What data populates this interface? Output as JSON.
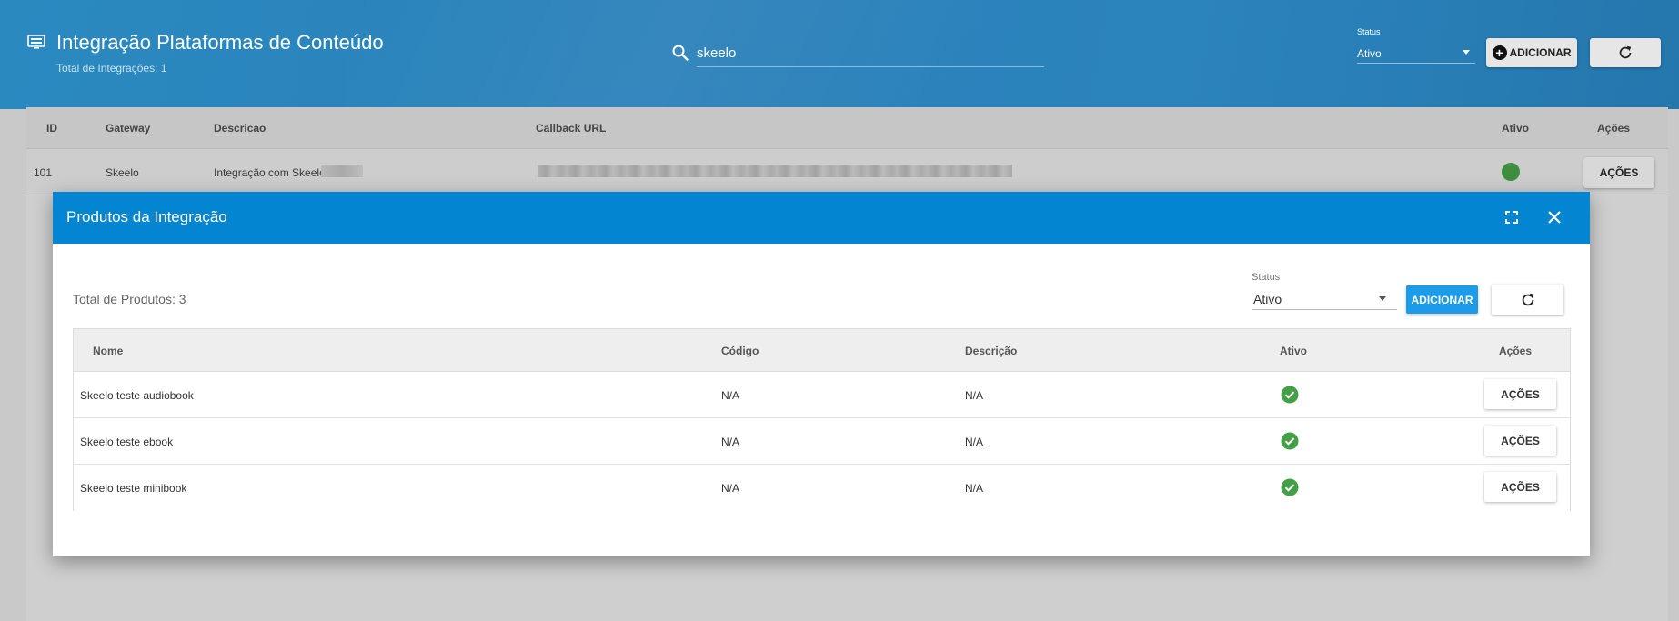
{
  "header": {
    "title": "Integração Plataformas de Conteúdo",
    "subtitle": "Total de Integrações: 1",
    "search_value": "skeelo",
    "status_label": "Status",
    "status_value": "Ativo",
    "add_label": "ADICIONAR",
    "icons": {
      "title": "monitor-list-icon",
      "search": "search-icon",
      "add": "plus-circle-icon",
      "refresh": "refresh-icon"
    }
  },
  "integrations": {
    "columns": [
      "ID",
      "Gateway",
      "Descricao",
      "Callback URL",
      "Ativo",
      "Ações"
    ],
    "rows": [
      {
        "id": "101",
        "gateway": "Skeelo",
        "descricao": "Integração com Skeelo",
        "action_label": "AÇÕES"
      }
    ]
  },
  "dialog": {
    "title": "Produtos da Integração",
    "total": "Total de Produtos: 3",
    "status_label": "Status",
    "status_value": "Ativo",
    "add_label": "ADICIONAR",
    "columns": [
      "Nome",
      "Código",
      "Descrição",
      "Ativo",
      "Ações"
    ],
    "rows": [
      {
        "nome": "Skeelo teste audiobook",
        "codigo": "N/A",
        "descricao": "N/A",
        "action_label": "AÇÕES"
      },
      {
        "nome": "Skeelo teste ebook",
        "codigo": "N/A",
        "descricao": "N/A",
        "action_label": "AÇÕES"
      },
      {
        "nome": "Skeelo teste minibook",
        "codigo": "N/A",
        "descricao": "N/A",
        "action_label": "AÇÕES"
      }
    ],
    "icons": {
      "expand": "fullscreen-icon",
      "close": "close-icon",
      "active": "check-circle-icon"
    }
  },
  "colors": {
    "header": "#2980b9",
    "dialog_bar": "#0385d1",
    "primary_button": "#1d9be6",
    "active": "#43a047"
  }
}
